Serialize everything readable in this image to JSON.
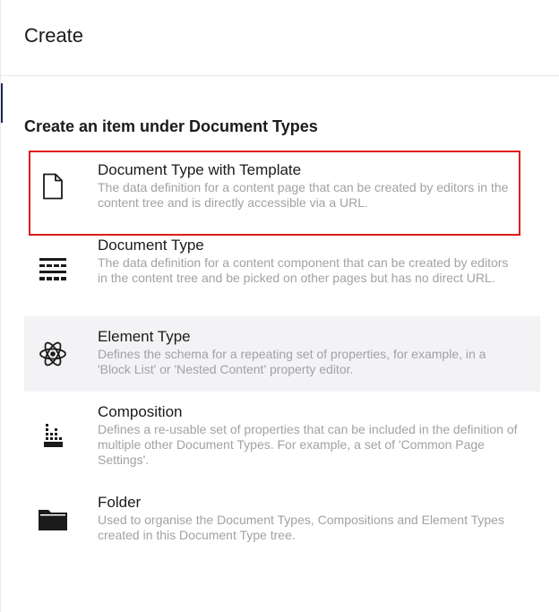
{
  "header": {
    "title": "Create"
  },
  "subtitle": "Create an item under Document Types",
  "items": [
    {
      "label": "Document Type with Template",
      "description": "The data definition for a content page that can be created by editors in the content tree and is directly accessible via a URL.",
      "icon": "document-icon"
    },
    {
      "label": "Document Type",
      "description": "The data definition for a content component that can be created by editors in the content tree and be picked on other pages but has no direct URL.",
      "icon": "document-type-icon"
    },
    {
      "label": "Element Type",
      "description": "Defines the schema for a repeating set of properties, for example, in a 'Block List' or 'Nested Content' property editor.",
      "icon": "atom-icon"
    },
    {
      "label": "Composition",
      "description": "Defines a re-usable set of properties that can be included in the definition of multiple other Document Types. For example, a set of 'Common Page Settings'.",
      "icon": "composition-icon"
    },
    {
      "label": "Folder",
      "description": "Used to organise the Document Types, Compositions and Element Types created in this Document Type tree.",
      "icon": "folder-icon"
    }
  ],
  "colors": {
    "highlight_border": "#e01b1b",
    "hover_background": "#f3f3f5",
    "description_text": "#a2a1a6"
  }
}
